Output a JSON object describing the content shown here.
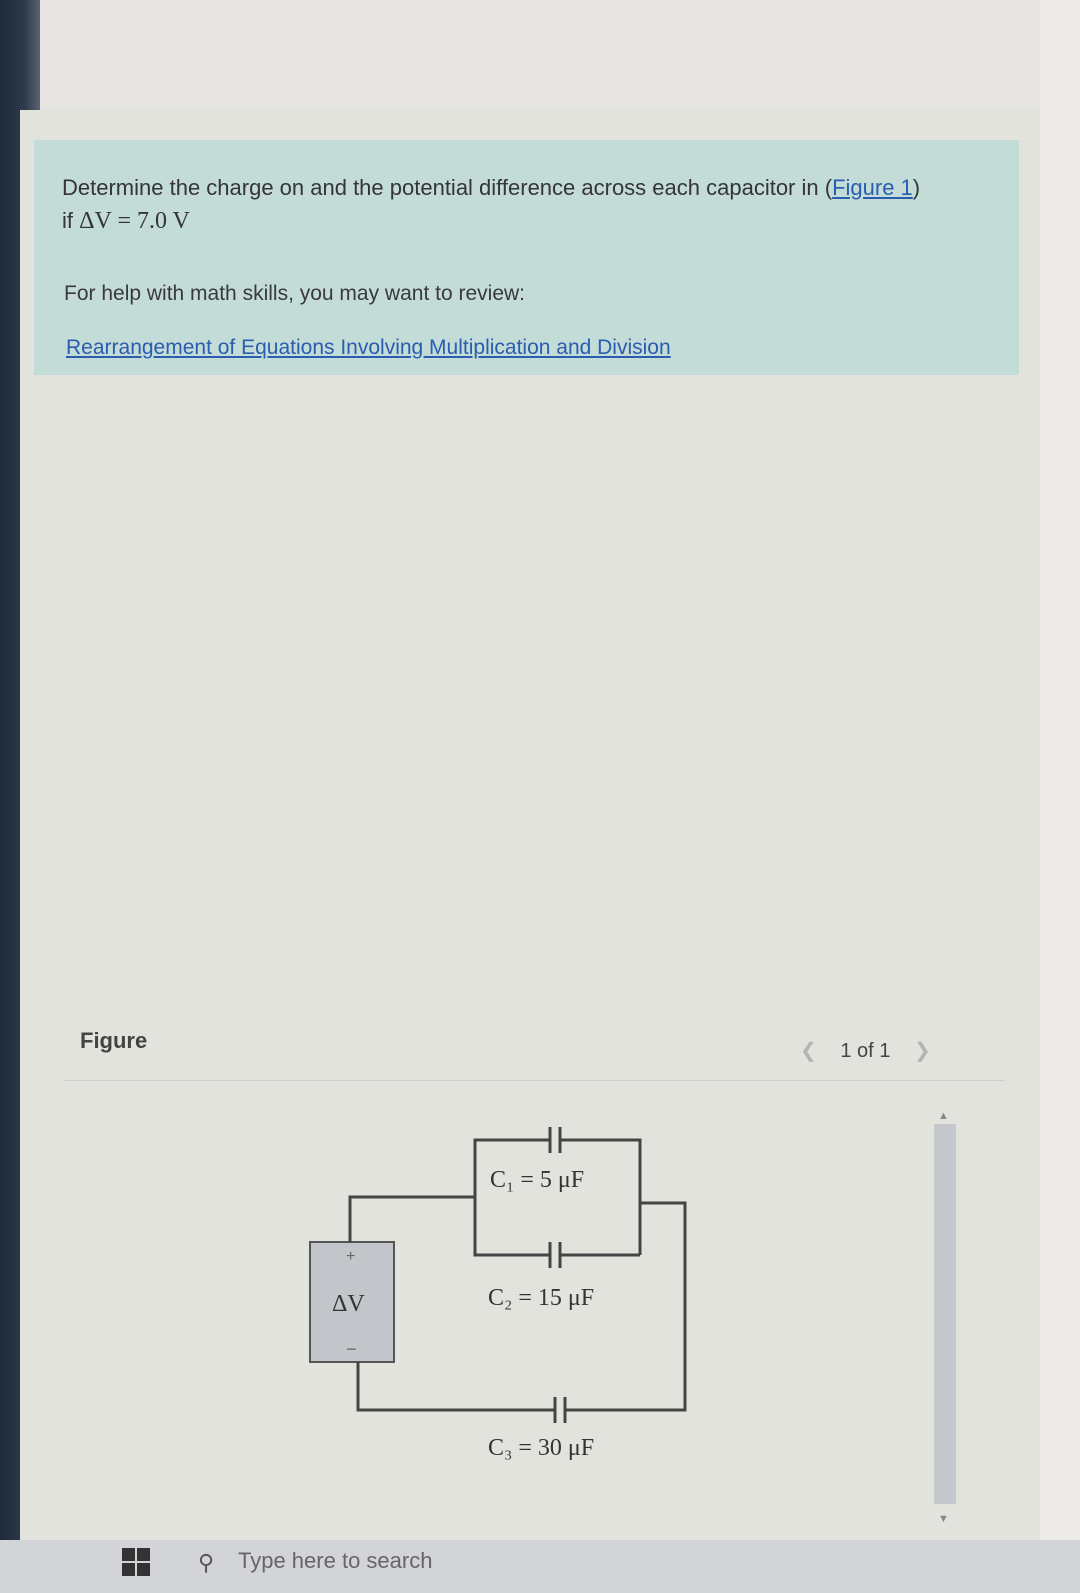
{
  "problem": {
    "question_text": "Determine the charge on and the potential difference across each capacitor in",
    "figure_link_text": "Figure 1",
    "condition_prefix": "if",
    "condition_math": "ΔV = 7.0 V",
    "help_text": "For help with math skills, you may want to review:",
    "review_link": "Rearrangement of Equations Involving Multiplication and Division"
  },
  "figure": {
    "header": "Figure",
    "pager_text": "1 of 1",
    "prev_icon": "chevron-left-icon",
    "next_icon": "chevron-right-icon"
  },
  "circuit": {
    "source_label": "ΔV",
    "plus_sign": "+",
    "minus_sign": "−",
    "capacitors": [
      {
        "label": "C₁ = 5 μF"
      },
      {
        "label": "C₂ = 15 μF"
      },
      {
        "label": "C₃ = 30 μF"
      }
    ]
  },
  "taskbar": {
    "start_icon": "windows-start-icon",
    "search_icon": "search-icon",
    "search_placeholder": "Type here to search"
  }
}
